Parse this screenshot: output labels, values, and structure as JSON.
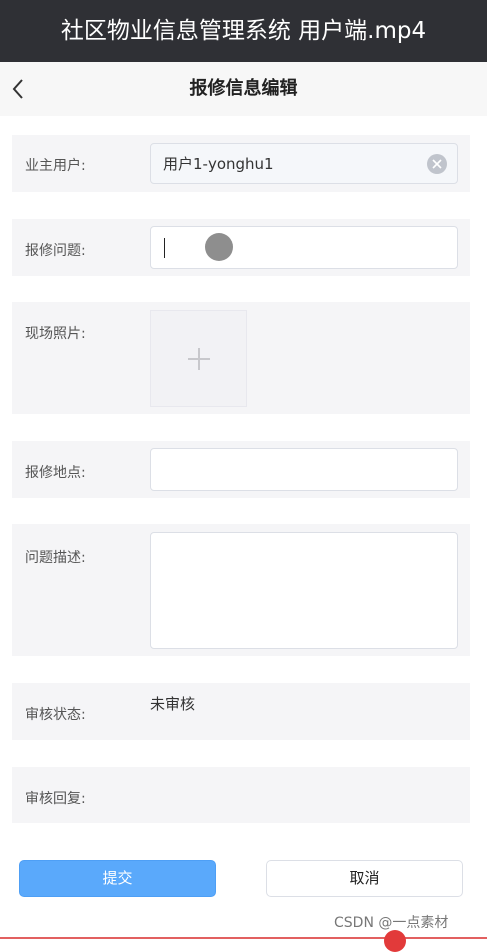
{
  "video_title": "社区物业信息管理系统 用户端.mp4",
  "navbar": {
    "title": "报修信息编辑",
    "back_icon": "chevron-left-icon"
  },
  "form": {
    "owner": {
      "label": "业主用户:",
      "value": "用户1-yonghu1",
      "clear_icon": "clear-circle-icon"
    },
    "issue": {
      "label": "报修问题:",
      "value": "",
      "placeholder": ""
    },
    "photo": {
      "label": "现场照片:",
      "upload_icon": "plus-icon"
    },
    "location": {
      "label": "报修地点:",
      "value": "",
      "placeholder": ""
    },
    "description": {
      "label": "问题描述:",
      "value": "",
      "placeholder": ""
    },
    "audit_status": {
      "label": "审核状态:",
      "value": "未审核"
    },
    "audit_reply": {
      "label": "审核回复:",
      "value": ""
    }
  },
  "buttons": {
    "submit": "提交",
    "cancel": "取消"
  },
  "watermark": "CSDN @一点素材",
  "colors": {
    "primary": "#5aa9fb",
    "title_bar": "#2f3035",
    "row_background": "#f5f5f7"
  }
}
